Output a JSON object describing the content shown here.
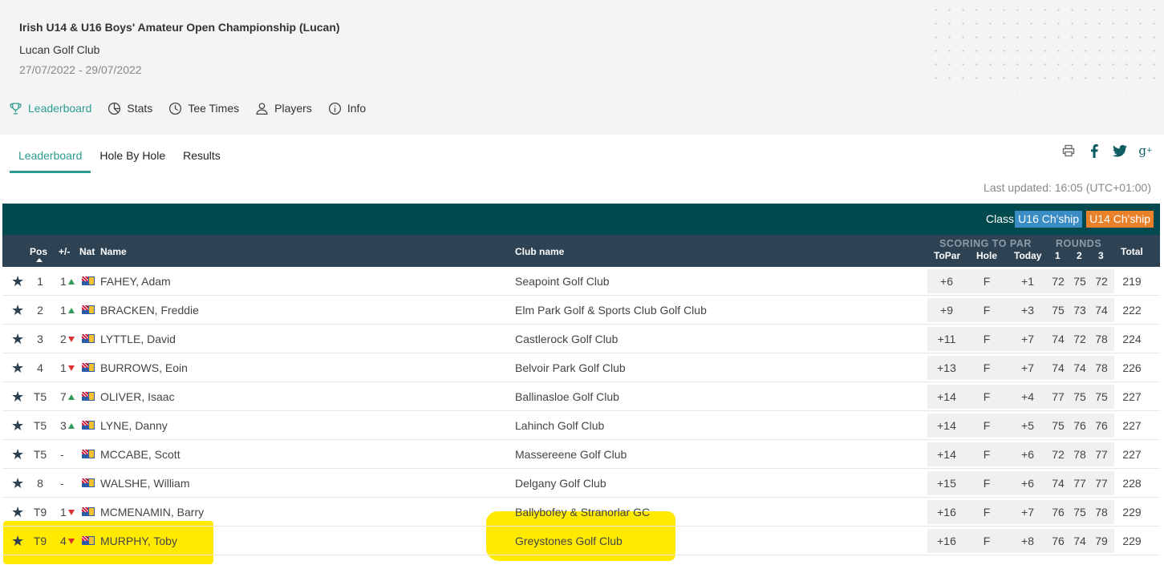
{
  "event": {
    "title": "Irish U14 & U16 Boys' Amateur Open Championship (Lucan)",
    "venue": "Lucan Golf Club",
    "dates": "27/07/2022 - 29/07/2022"
  },
  "topnav": [
    {
      "label": "Leaderboard",
      "icon": "trophy-icon"
    },
    {
      "label": "Stats",
      "icon": "pie-chart-icon"
    },
    {
      "label": "Tee Times",
      "icon": "clock-icon"
    },
    {
      "label": "Players",
      "icon": "user-icon"
    },
    {
      "label": "Info",
      "icon": "info-icon"
    }
  ],
  "subtabs": [
    "Leaderboard",
    "Hole By Hole",
    "Results"
  ],
  "share_icons": [
    "print-icon",
    "facebook-icon",
    "twitter-icon",
    "google-plus-icon"
  ],
  "last_updated": "Last updated: 16:05 (UTC+01:00)",
  "class_bar": {
    "label": "Class",
    "u16": "U16 Ch'ship",
    "u14": "U14 Ch'ship"
  },
  "columns": {
    "pos": "Pos",
    "move": "+/-",
    "nat": "Nat",
    "name": "Name",
    "club": "Club name",
    "scoring_group": "SCORING TO PAR",
    "rounds_group": "ROUNDS",
    "topar": "ToPar",
    "hole": "Hole",
    "today": "Today",
    "r1": "1",
    "r2": "2",
    "r3": "3",
    "total": "Total"
  },
  "rows": [
    {
      "pos": "1",
      "move": "1",
      "dir": "up",
      "name": "FAHEY, Adam",
      "club": "Seapoint Golf Club",
      "topar": "+6",
      "hole": "F",
      "today": "+1",
      "r1": "72",
      "r2": "75",
      "r3": "72",
      "total": "219"
    },
    {
      "pos": "2",
      "move": "1",
      "dir": "up",
      "name": "BRACKEN, Freddie",
      "club": "Elm Park Golf & Sports Club Golf Club",
      "topar": "+9",
      "hole": "F",
      "today": "+3",
      "r1": "75",
      "r2": "73",
      "r3": "74",
      "total": "222"
    },
    {
      "pos": "3",
      "move": "2",
      "dir": "down",
      "name": "LYTTLE, David",
      "club": "Castlerock Golf Club",
      "topar": "+11",
      "hole": "F",
      "today": "+7",
      "r1": "74",
      "r2": "72",
      "r3": "78",
      "total": "224"
    },
    {
      "pos": "4",
      "move": "1",
      "dir": "down",
      "name": "BURROWS, Eoin",
      "club": "Belvoir Park Golf Club",
      "topar": "+13",
      "hole": "F",
      "today": "+7",
      "r1": "74",
      "r2": "74",
      "r3": "78",
      "total": "226"
    },
    {
      "pos": "T5",
      "move": "7",
      "dir": "up",
      "name": "OLIVER, Isaac",
      "club": "Ballinasloe Golf Club",
      "topar": "+14",
      "hole": "F",
      "today": "+4",
      "r1": "77",
      "r2": "75",
      "r3": "75",
      "total": "227"
    },
    {
      "pos": "T5",
      "move": "3",
      "dir": "up",
      "name": "LYNE, Danny",
      "club": "Lahinch Golf Club",
      "topar": "+14",
      "hole": "F",
      "today": "+5",
      "r1": "75",
      "r2": "76",
      "r3": "76",
      "total": "227"
    },
    {
      "pos": "T5",
      "move": "-",
      "dir": "none",
      "name": "MCCABE, Scott",
      "club": "Massereene Golf Club",
      "topar": "+14",
      "hole": "F",
      "today": "+6",
      "r1": "72",
      "r2": "78",
      "r3": "77",
      "total": "227"
    },
    {
      "pos": "8",
      "move": "-",
      "dir": "none",
      "name": "WALSHE, William",
      "club": "Delgany Golf Club",
      "topar": "+15",
      "hole": "F",
      "today": "+6",
      "r1": "74",
      "r2": "77",
      "r3": "77",
      "total": "228"
    },
    {
      "pos": "T9",
      "move": "1",
      "dir": "down",
      "name": "MCMENAMIN, Barry",
      "club": "Ballybofey & Stranorlar GC",
      "topar": "+16",
      "hole": "F",
      "today": "+7",
      "r1": "76",
      "r2": "75",
      "r3": "78",
      "total": "229"
    },
    {
      "pos": "T9",
      "move": "4",
      "dir": "down",
      "name": "MURPHY, Toby",
      "club": "Greystones Golf Club",
      "topar": "+16",
      "hole": "F",
      "today": "+8",
      "r1": "76",
      "r2": "74",
      "r3": "79",
      "total": "229"
    }
  ],
  "colors": {
    "accent": "#2a9d8f",
    "class_bar": "#004a4f",
    "header_row": "#2d4253",
    "u16_pill": "#3a8cc4",
    "u14_pill": "#e8812a",
    "highlight": "#ffea00"
  }
}
